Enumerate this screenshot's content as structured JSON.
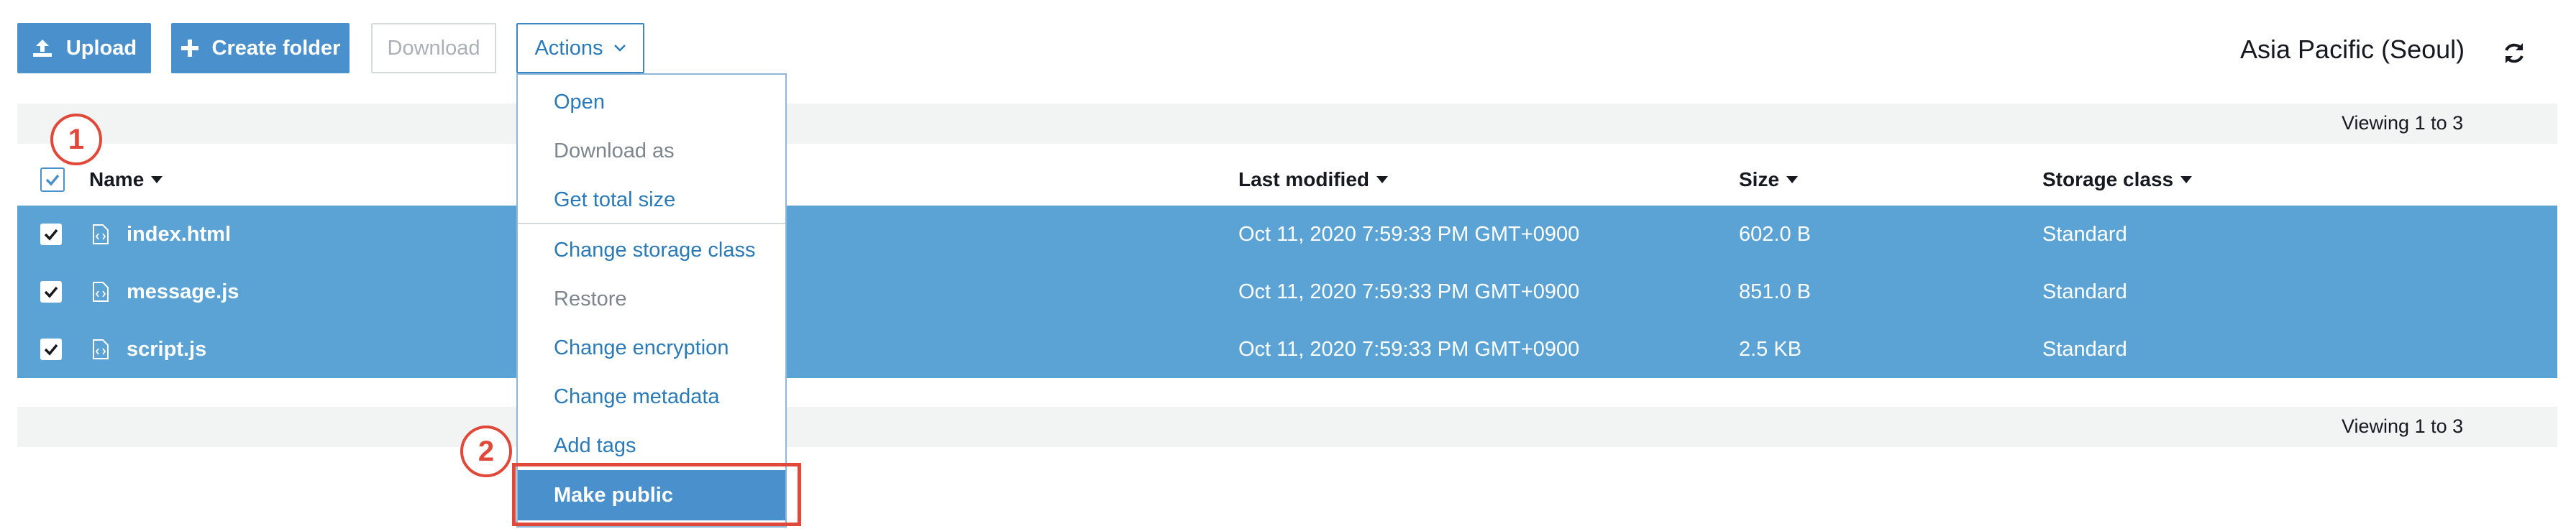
{
  "toolbar": {
    "upload_label": "Upload",
    "create_folder_label": "Create folder",
    "download_label": "Download",
    "actions_label": "Actions"
  },
  "region": "Asia Pacific (Seoul)",
  "viewing_top": "Viewing 1 to 3",
  "viewing_bottom": "Viewing 1 to 3",
  "columns": {
    "name": "Name",
    "last_modified": "Last modified",
    "size": "Size",
    "storage_class": "Storage class"
  },
  "rows": [
    {
      "name": "index.html",
      "modified": "Oct 11, 2020 7:59:33 PM GMT+0900",
      "size": "602.0 B",
      "storage": "Standard"
    },
    {
      "name": "message.js",
      "modified": "Oct 11, 2020 7:59:33 PM GMT+0900",
      "size": "851.0 B",
      "storage": "Standard"
    },
    {
      "name": "script.js",
      "modified": "Oct 11, 2020 7:59:33 PM GMT+0900",
      "size": "2.5 KB",
      "storage": "Standard"
    }
  ],
  "menu": {
    "items": [
      "Open",
      "Download as",
      "Get total size",
      "Change storage class",
      "Restore",
      "Change encryption",
      "Change metadata",
      "Add tags",
      "Make public"
    ]
  },
  "annotations": {
    "badge1": "1",
    "badge2": "2"
  },
  "colors": {
    "accent": "#4a90cc",
    "selected_row": "#5ba3d4",
    "annotation": "#e0493a"
  }
}
